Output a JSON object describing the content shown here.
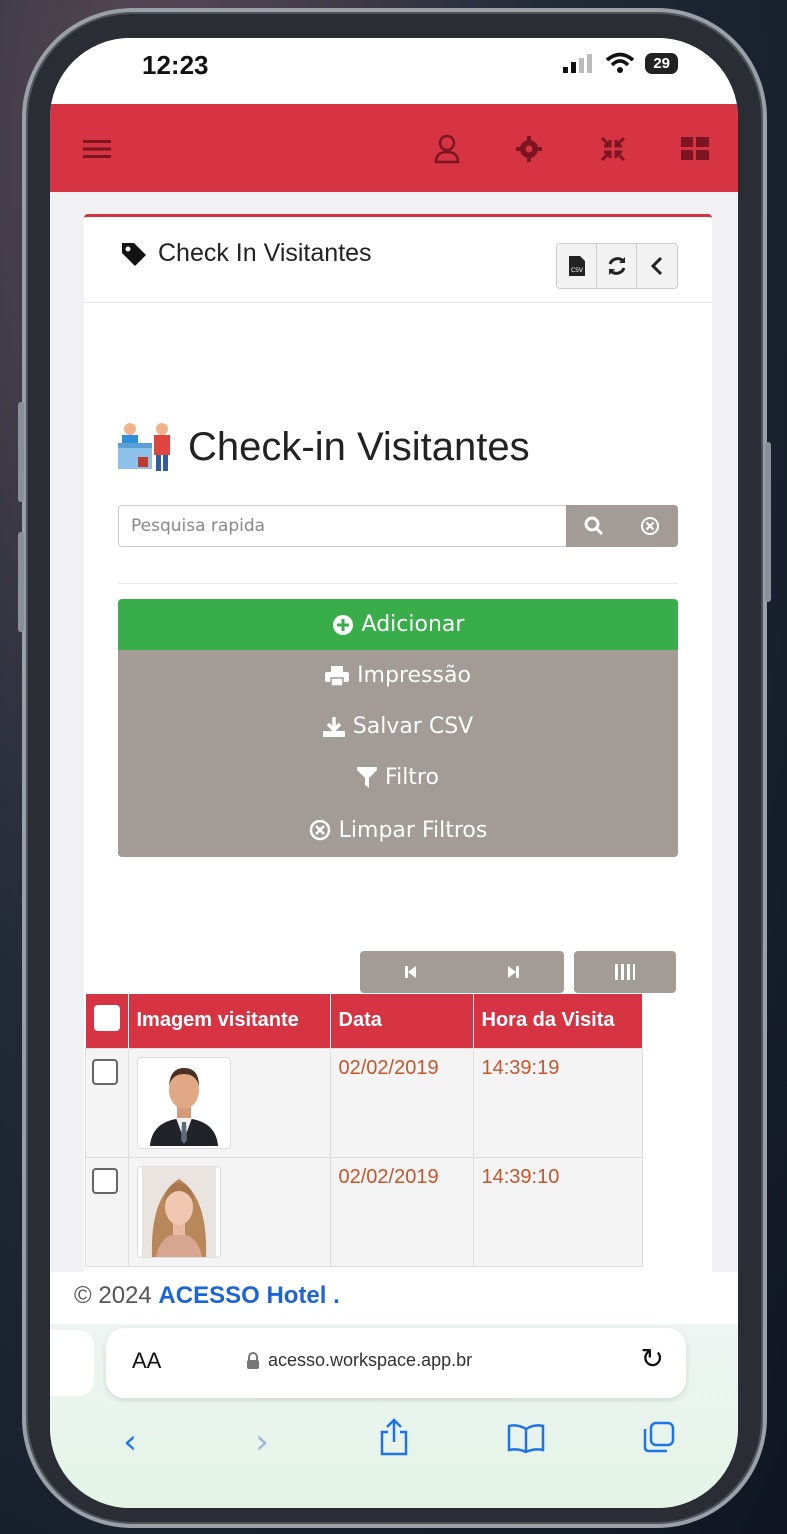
{
  "status_bar": {
    "time": "12:23",
    "battery": "29"
  },
  "topbar": {
    "icons": [
      "menu-icon",
      "user-icon",
      "gear-icon",
      "compress-icon",
      "grid-icon"
    ]
  },
  "card": {
    "title": "Check In Visitantes",
    "header_buttons": [
      "csv-icon",
      "refresh-icon",
      "back-chevron-icon"
    ]
  },
  "page": {
    "heading": "Check-in Visitantes"
  },
  "search": {
    "placeholder": "Pesquisa rapida"
  },
  "actions": [
    {
      "label": "Adicionar",
      "icon": "plus-circle-icon"
    },
    {
      "label": "Impressão",
      "icon": "print-icon"
    },
    {
      "label": "Salvar CSV",
      "icon": "download-icon"
    },
    {
      "label": "Filtro",
      "icon": "filter-icon"
    },
    {
      "label": "Limpar Filtros",
      "icon": "clear-circle-icon"
    }
  ],
  "table": {
    "columns": [
      "Imagem visitante",
      "Data",
      "Hora da Visita"
    ],
    "rows": [
      {
        "date": "02/02/2019",
        "time": "14:39:19",
        "photo": "man-portrait"
      },
      {
        "date": "02/02/2019",
        "time": "14:39:10",
        "photo": "woman-portrait"
      }
    ]
  },
  "footer": {
    "copyright": "© 2024 ",
    "brand": "ACESSO Hotel",
    "suffix": " ."
  },
  "browser": {
    "aa": "AA",
    "url": "acesso.workspace.app.br"
  },
  "colors": {
    "accent": "#d63343",
    "success": "#38ad49",
    "neutral": "#a39b95",
    "date_text": "#c5562a"
  }
}
